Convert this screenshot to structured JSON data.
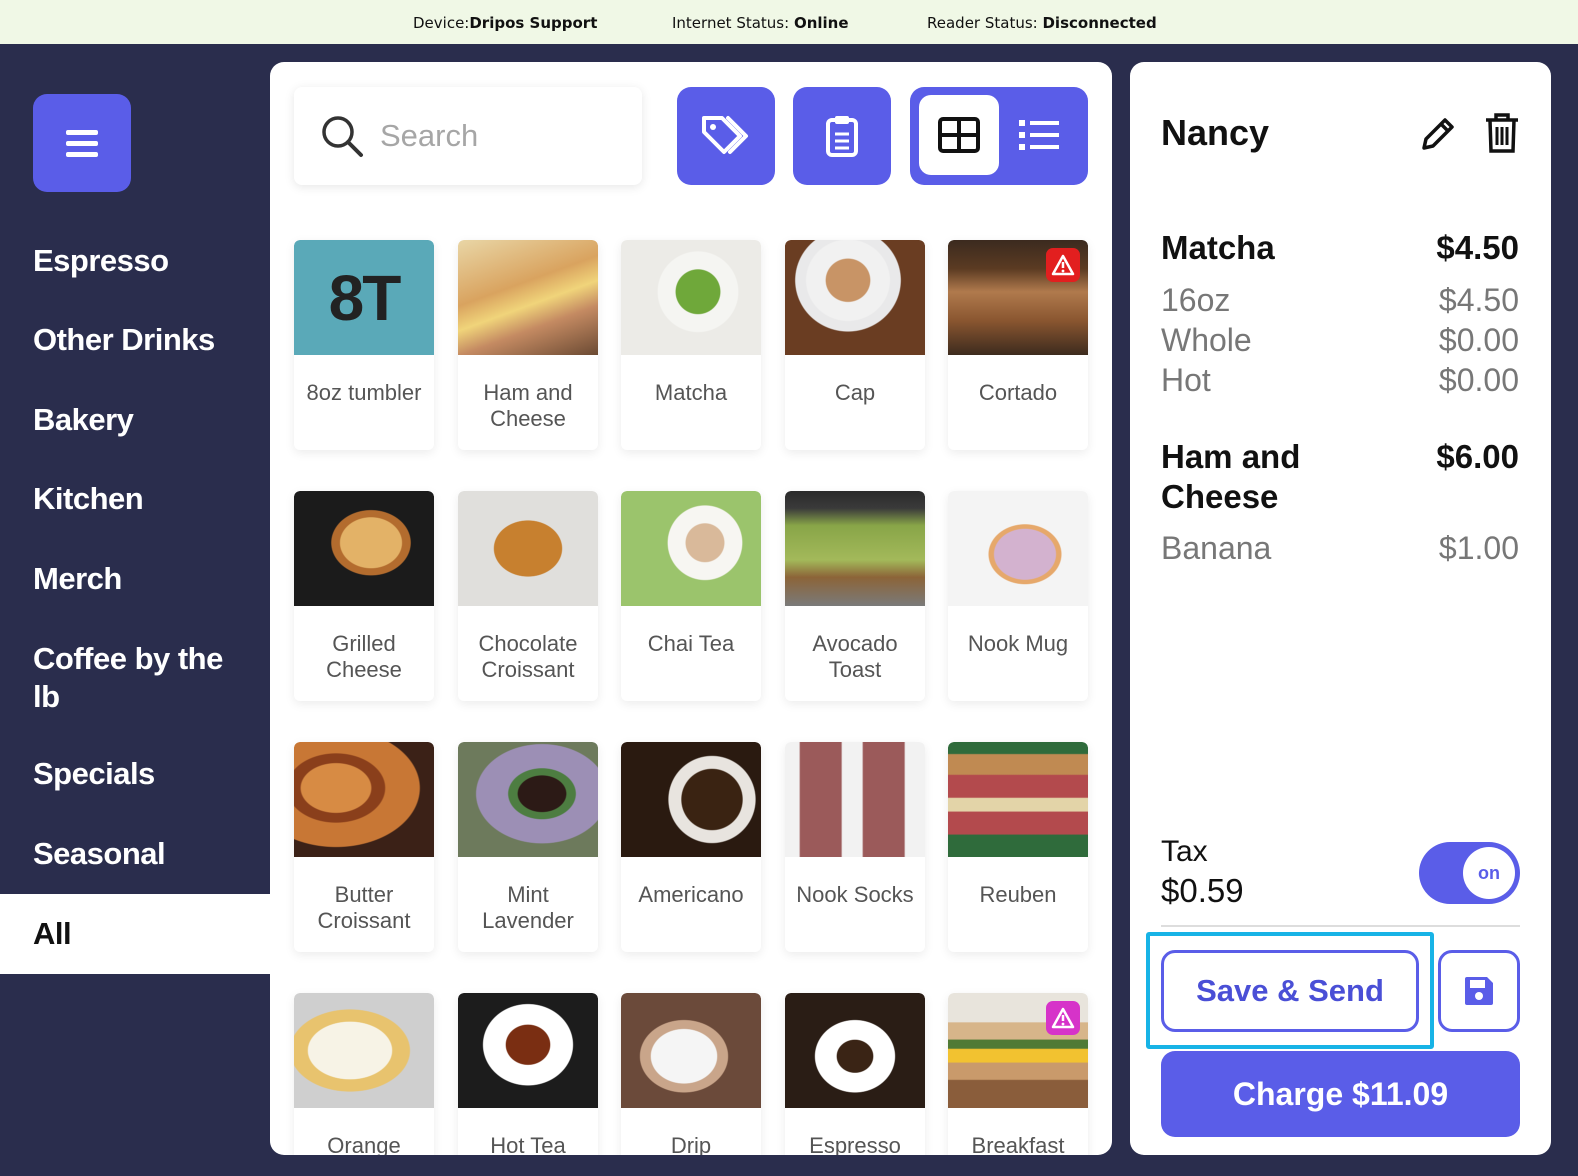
{
  "status": {
    "device_label": "Device:",
    "device_value": "Dripos Support",
    "internet_label": "Internet Status: ",
    "internet_value": "Online",
    "reader_label": "Reader Status: ",
    "reader_value": "Disconnected"
  },
  "sidebar": {
    "categories": [
      "Espresso",
      "Other Drinks",
      "Bakery",
      "Kitchen",
      "Merch",
      "Coffee by the lb",
      "Specials",
      "Seasonal",
      "All"
    ],
    "active": "All"
  },
  "search": {
    "placeholder": "Search"
  },
  "products": [
    {
      "name": "8oz tumbler",
      "image_text": "8T"
    },
    {
      "name": "Ham and Cheese"
    },
    {
      "name": "Matcha"
    },
    {
      "name": "Cap"
    },
    {
      "name": "Cortado",
      "warning": "red"
    },
    {
      "name": "Grilled Cheese"
    },
    {
      "name": "Chocolate Croissant"
    },
    {
      "name": "Chai Tea"
    },
    {
      "name": "Avocado Toast"
    },
    {
      "name": "Nook Mug"
    },
    {
      "name": "Butter Croissant"
    },
    {
      "name": "Mint Lavender"
    },
    {
      "name": "Americano"
    },
    {
      "name": "Nook Socks"
    },
    {
      "name": "Reuben"
    },
    {
      "name": "Orange"
    },
    {
      "name": "Hot Tea"
    },
    {
      "name": "Drip"
    },
    {
      "name": "Espresso"
    },
    {
      "name": "Breakfast",
      "warning": "magenta"
    }
  ],
  "order": {
    "customer": "Nancy",
    "items": [
      {
        "name": "Matcha",
        "price": "$4.50",
        "mods": [
          {
            "name": "16oz",
            "price": "$4.50"
          },
          {
            "name": "Whole",
            "price": "$0.00"
          },
          {
            "name": "Hot",
            "price": "$0.00"
          }
        ]
      },
      {
        "name": "Ham and Cheese",
        "price": "$6.00",
        "mods": [
          {
            "name": "Banana",
            "price": "$1.00"
          }
        ]
      }
    ],
    "tax_label": "Tax",
    "tax_value": "$0.59",
    "tax_toggle": "on",
    "save_send_label": "Save & Send",
    "charge_label": "Charge $11.09"
  },
  "colors": {
    "accent": "#5a5de8",
    "sidebar": "#2a2d4d",
    "status_bar": "#f0f8e6",
    "focus": "#17b3e6"
  }
}
